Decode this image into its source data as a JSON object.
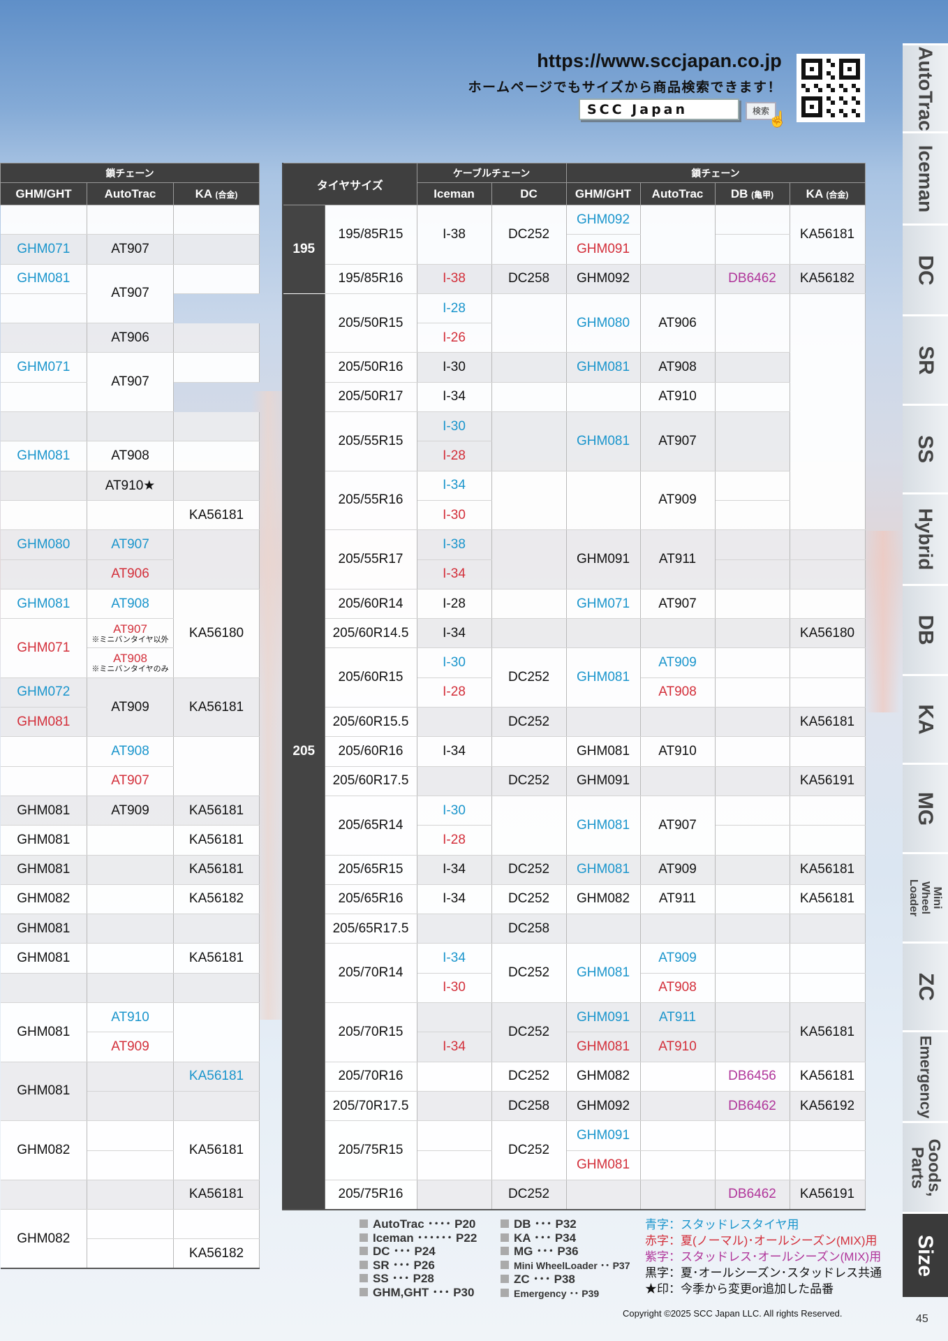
{
  "header": {
    "url": "https://www.sccjapan.co.jp",
    "subtitle": "ホームページでもサイズから商品検索できます！",
    "search_value": "SCC Japan",
    "search_button": "検索"
  },
  "left_table": {
    "super_header": "鎖チェーン",
    "columns": [
      "GHM/GHT",
      "AutoTrac",
      "KA"
    ],
    "ka_note": "(合金)"
  },
  "right_table": {
    "tire_size_header": "タイヤサイズ",
    "cable_header": "ケーブルチェーン",
    "chain_header": "鎖チェーン",
    "columns": [
      "Iceman",
      "DC",
      "GHM/GHT",
      "AutoTrac",
      "DB",
      "KA"
    ],
    "db_note": "(亀甲)",
    "ka_note": "(合金)",
    "groups": [
      "195",
      "205"
    ]
  },
  "left_rows": [
    {
      "g": "",
      "a": "",
      "k": "",
      "bg": "w"
    },
    {
      "g": "GHM071",
      "gc": "blue",
      "a": "AT907",
      "k": "",
      "bg": "g"
    },
    {
      "g": "GHM081",
      "gc": "blue",
      "a": "AT907",
      "k": "",
      "bg": "w"
    },
    {
      "g": "",
      "bg": "w"
    },
    {
      "g": "",
      "a": "AT906",
      "k": "",
      "bg": "g"
    },
    {
      "g": "GHM071",
      "gc": "blue",
      "a": "AT907",
      "k": "",
      "bg": "w"
    },
    {
      "g": "",
      "bg": "w"
    },
    {
      "g": "",
      "a": "",
      "k": "",
      "bg": "g"
    },
    {
      "g": "GHM081",
      "gc": "blue",
      "a": "AT908",
      "k": "",
      "bg": "w"
    },
    {
      "g": "",
      "a": "AT910★",
      "k": "",
      "bg": "g"
    },
    {
      "g": "",
      "a": "",
      "k": "KA56181",
      "bg": "w"
    },
    {
      "g": "GHM080",
      "gc": "blue",
      "a": "AT907",
      "ac": "blue",
      "k": "",
      "bg": "g"
    },
    {
      "g": "",
      "a": "AT906",
      "ac": "red",
      "bg": "g"
    },
    {
      "g": "GHM081",
      "gc": "blue",
      "a": "AT908",
      "ac": "blue",
      "k": "KA56180",
      "bg": "w"
    },
    {
      "g": "GHM071",
      "gc": "red",
      "a": "AT907",
      "ac": "red",
      "an": "※ミニバンタイヤ以外",
      "bg": "w"
    },
    {
      "a": "AT908",
      "ac": "red",
      "an": "※ミニバンタイヤのみ",
      "bg": "w"
    },
    {
      "g": "GHM072",
      "gc": "blue",
      "a": "AT909",
      "k": "KA56181",
      "bg": "g"
    },
    {
      "g": "GHM081",
      "gc": "red",
      "bg": "g"
    },
    {
      "g": "",
      "a": "AT908",
      "ac": "blue",
      "k": "",
      "bg": "w"
    },
    {
      "g": "",
      "a": "AT907",
      "ac": "red",
      "bg": "w"
    },
    {
      "g": "GHM081",
      "a": "AT909",
      "k": "KA56181",
      "bg": "g"
    },
    {
      "g": "GHM081",
      "a": "",
      "k": "KA56181",
      "bg": "w"
    },
    {
      "g": "GHM081",
      "a": "",
      "k": "KA56181",
      "bg": "g"
    },
    {
      "g": "GHM082",
      "a": "",
      "k": "KA56182",
      "bg": "w"
    },
    {
      "g": "GHM081",
      "a": "",
      "k": "",
      "bg": "g"
    },
    {
      "g": "GHM081",
      "a": "",
      "k": "KA56181",
      "bg": "w"
    },
    {
      "g": "",
      "a": "",
      "k": "",
      "bg": "g"
    },
    {
      "g": "GHM081",
      "a": "AT910",
      "ac": "blue",
      "k": "",
      "bg": "w"
    },
    {
      "a": "AT909",
      "ac": "red",
      "k": "",
      "bg": "w"
    },
    {
      "g": "GHM081",
      "a": "",
      "k": "KA56181",
      "kc": "blue",
      "bg": "g"
    },
    {
      "a": "",
      "k": "",
      "bg": "g"
    },
    {
      "g": "GHM082",
      "a": "",
      "k": "KA56181",
      "bg": "w"
    },
    {
      "a": "",
      "bg": "w"
    },
    {
      "g": "",
      "a": "",
      "k": "KA56181",
      "bg": "g"
    },
    {
      "g": "GHM082",
      "a": "",
      "k": "",
      "bg": "w"
    },
    {
      "a": "",
      "k": "KA56182",
      "bg": "w"
    }
  ],
  "right_rows": [
    {
      "size": "195/85R15",
      "i": "I-38",
      "d": "DC252",
      "g": "GHM092",
      "gc": "blue",
      "a": "",
      "db": "",
      "k": "KA56181",
      "bg": "w"
    },
    {
      "g": "GHM091",
      "gc": "red",
      "a": "",
      "db": "",
      "bg": "w"
    },
    {
      "size": "195/85R16",
      "i": "I-38",
      "ic": "red",
      "d": "DC258",
      "g": "GHM092",
      "a": "",
      "db": "DB6462",
      "dbc": "pur",
      "k": "KA56182",
      "bg": "g"
    },
    {
      "size": "205/50R15",
      "i": "I-28",
      "ic": "blue",
      "d": "",
      "g": "GHM080",
      "gc": "blue",
      "a": "AT906",
      "db": "",
      "k": "",
      "bg": "w"
    },
    {
      "i": "I-26",
      "ic": "red",
      "d": "",
      "g": "",
      "db": "",
      "bg": "w"
    },
    {
      "size": "205/50R16",
      "i": "I-30",
      "d": "",
      "g": "GHM081",
      "gc": "blue",
      "a": "AT908",
      "db": "",
      "k": "",
      "bg": "g"
    },
    {
      "size": "205/50R17",
      "i": "I-34",
      "d": "",
      "g": "",
      "a": "AT910",
      "db": "",
      "k": "",
      "bg": "w"
    },
    {
      "size": "205/55R15",
      "i": "I-30",
      "ic": "blue",
      "d": "",
      "g": "GHM081",
      "gc": "blue",
      "a": "AT907",
      "db": "",
      "k": "",
      "bg": "g"
    },
    {
      "i": "I-28",
      "ic": "red",
      "d": "",
      "g": "",
      "db": "",
      "bg": "g"
    },
    {
      "size": "205/55R16",
      "i": "I-34",
      "ic": "blue",
      "d": "",
      "g": "",
      "a": "AT909",
      "db": "",
      "k": "",
      "bg": "w"
    },
    {
      "i": "I-30",
      "ic": "red",
      "d": "",
      "g": "",
      "db": "",
      "k": "",
      "bg": "w"
    },
    {
      "size": "205/55R17",
      "i": "I-38",
      "ic": "blue",
      "d": "",
      "g": "GHM091",
      "a": "AT911",
      "db": "",
      "k": "",
      "bg": "g"
    },
    {
      "i": "I-34",
      "ic": "red",
      "d": "",
      "db": "",
      "k": "",
      "bg": "g"
    },
    {
      "size": "205/60R14",
      "i": "I-28",
      "d": "",
      "g": "GHM071",
      "gc": "blue",
      "a": "AT907",
      "db": "",
      "k": "",
      "bg": "w"
    },
    {
      "size": "205/60R14.5",
      "i": "I-34",
      "d": "",
      "g": "",
      "a": "",
      "db": "",
      "k": "KA56180",
      "bg": "g"
    },
    {
      "size": "205/60R15",
      "i": "I-30",
      "ic": "blue",
      "d": "DC252",
      "g": "GHM081",
      "gc": "blue",
      "a": "AT909",
      "ac": "blue",
      "db": "",
      "k": "",
      "bg": "w"
    },
    {
      "i": "I-28",
      "ic": "red",
      "g": "",
      "a": "AT908",
      "ac": "red",
      "db": "",
      "k": "",
      "bg": "w"
    },
    {
      "size": "205/60R15.5",
      "i": "",
      "d": "DC252",
      "g": "",
      "a": "",
      "db": "",
      "k": "KA56181",
      "bg": "g"
    },
    {
      "size": "205/60R16",
      "i": "I-34",
      "d": "",
      "g": "GHM081",
      "a": "AT910",
      "db": "",
      "k": "",
      "bg": "w"
    },
    {
      "size": "205/60R17.5",
      "i": "",
      "d": "DC252",
      "g": "GHM091",
      "a": "",
      "db": "",
      "k": "KA56191",
      "bg": "g"
    },
    {
      "size": "205/65R14",
      "i": "I-30",
      "ic": "blue",
      "d": "",
      "g": "GHM081",
      "gc": "blue",
      "a": "AT907",
      "db": "",
      "k": "",
      "bg": "w"
    },
    {
      "i": "I-28",
      "ic": "red",
      "d": "",
      "g": "",
      "db": "",
      "k": "",
      "bg": "w"
    },
    {
      "size": "205/65R15",
      "i": "I-34",
      "d": "DC252",
      "g": "GHM081",
      "gc": "blue",
      "a": "AT909",
      "db": "",
      "k": "KA56181",
      "bg": "g"
    },
    {
      "size": "205/65R16",
      "i": "I-34",
      "d": "DC252",
      "g": "GHM082",
      "a": "AT911",
      "db": "",
      "k": "KA56181",
      "bg": "w"
    },
    {
      "size": "205/65R17.5",
      "i": "",
      "d": "DC258",
      "g": "",
      "a": "",
      "db": "",
      "k": "",
      "bg": "g"
    },
    {
      "size": "205/70R14",
      "i": "I-34",
      "ic": "blue",
      "d": "DC252",
      "g": "GHM081",
      "gc": "blue",
      "a": "AT909",
      "ac": "blue",
      "db": "",
      "k": "",
      "bg": "w"
    },
    {
      "i": "I-30",
      "ic": "red",
      "g": "",
      "a": "AT908",
      "ac": "red",
      "db": "",
      "k": "",
      "bg": "w"
    },
    {
      "size": "205/70R15",
      "i": "",
      "d": "DC252",
      "g": "GHM091",
      "gc": "blue",
      "a": "AT911",
      "ac": "blue",
      "db": "",
      "k": "KA56181",
      "bg": "g"
    },
    {
      "i": "I-34",
      "ic": "red",
      "g": "GHM081",
      "gc": "red",
      "a": "AT910",
      "ac": "red",
      "db": "",
      "bg": "g"
    },
    {
      "size": "205/70R16",
      "i": "",
      "d": "DC252",
      "g": "GHM082",
      "a": "",
      "db": "DB6456",
      "dbc": "pur",
      "k": "KA56181",
      "bg": "w"
    },
    {
      "size": "205/70R17.5",
      "i": "",
      "d": "DC258",
      "g": "GHM092",
      "a": "",
      "db": "DB6462",
      "dbc": "pur",
      "k": "KA56192",
      "bg": "g"
    },
    {
      "size": "205/75R15",
      "i": "",
      "d": "DC252",
      "g": "GHM091",
      "gc": "blue",
      "a": "",
      "db": "",
      "k": "",
      "bg": "w"
    },
    {
      "i": "",
      "g": "GHM081",
      "gc": "red",
      "a": "",
      "db": "",
      "k": "",
      "bg": "w"
    },
    {
      "size": "205/75R16",
      "i": "",
      "d": "DC252",
      "g": "",
      "a": "",
      "db": "DB6462",
      "dbc": "pur",
      "k": "KA56191",
      "bg": "g"
    }
  ],
  "legend": {
    "col1": [
      "AutoTrac ････ P20",
      "Iceman ･･････ P22",
      "DC ･･･ P24",
      "SR ･･･ P26",
      "SS ･･･ P28",
      "GHM,GHT ･･･ P30"
    ],
    "col2": [
      "DB ･･･ P32",
      "KA ･･･ P34",
      "MG ･･･ P36",
      "Mini WheelLoader ･･ P37",
      "ZC ･･･ P38",
      "Emergency ･･ P39"
    ],
    "col3": [
      {
        "text": "青字：スタッドレスタイヤ用",
        "color": "blue"
      },
      {
        "text": "赤字：夏(ノーマル)･オールシーズン(MIX)用",
        "color": "red"
      },
      {
        "text": "紫字：スタッドレス･オールシーズン(MIX)用",
        "color": "pur"
      },
      {
        "text": "黒字：夏･オールシーズン･スタッドレス共通",
        "color": "blk"
      },
      {
        "text": "★印：今季から変更or追加した品番",
        "color": "blk"
      }
    ]
  },
  "copyright": "Copyright ©2025 SCC Japan LLC. All rights Reserved.",
  "page_number": "45",
  "side_tabs": [
    "AutoTrac",
    "Iceman",
    "DC",
    "SR",
    "SS",
    "Hybrid",
    "DB",
    "KA",
    "MG",
    "Mini Wheel Loader",
    "ZC",
    "Emergency",
    "Goods, Parts",
    "Size"
  ],
  "colors": {
    "blue": "#1a95cc",
    "red": "#d32f3a",
    "purple": "#b0359a",
    "header": "#3f3f3f"
  }
}
